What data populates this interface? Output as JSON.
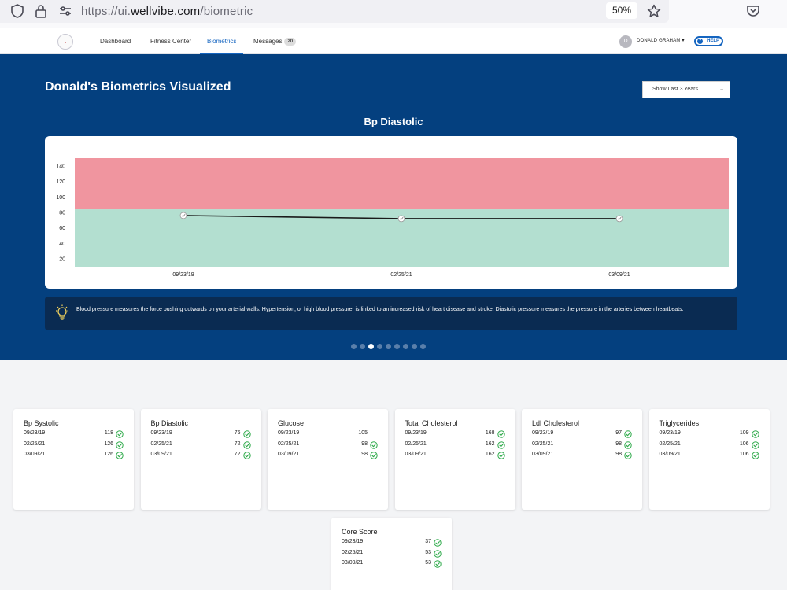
{
  "browser": {
    "url_prefix": "https://ui.",
    "url_domain": "wellvibe.com",
    "url_path": "/biometric",
    "zoom": "50%"
  },
  "nav": {
    "links": [
      "Dashboard",
      "Fitness Center",
      "Biometrics",
      "Messages"
    ],
    "messages_count": "20",
    "avatar_initial": "D",
    "user_name": "DONALD GRAHAM",
    "help_label": "HELP"
  },
  "hero": {
    "title": "Donald's Biometrics Visualized",
    "range_selected": "Show Last 3 Years",
    "tip": "Blood pressure measures the force pushing outwards on your arterial walls. Hypertension, or high blood pressure, is linked to an increased risk of heart disease and stroke. Diastolic pressure measures the pressure in the arteries between heartbeats.",
    "carousel_total": 9,
    "carousel_active": 3
  },
  "chart_data": {
    "type": "line",
    "title": "Bp Diastolic",
    "categories": [
      "09/23/19",
      "02/25/21",
      "03/09/21"
    ],
    "values": [
      76,
      72,
      72
    ],
    "yticks": [
      20,
      40,
      60,
      80,
      100,
      120,
      140
    ],
    "ylim": [
      10,
      150
    ],
    "bands": [
      {
        "from": 10,
        "to": 84,
        "color": "#b3dfd0"
      },
      {
        "from": 84,
        "to": 150,
        "color": "#f0959f"
      }
    ],
    "line_color": "#1a1a1a",
    "grid": false
  },
  "colors": {
    "hero_bg": "#04407f",
    "accent": "#1565c0",
    "ok_green": "#2eaa4a"
  },
  "cards": [
    {
      "title": "Bp Systolic",
      "rows": [
        {
          "date": "09/23/19",
          "value": "118"
        },
        {
          "date": "02/25/21",
          "value": "126"
        },
        {
          "date": "03/09/21",
          "value": "126"
        }
      ]
    },
    {
      "title": "Bp Diastolic",
      "rows": [
        {
          "date": "09/23/19",
          "value": "76"
        },
        {
          "date": "02/25/21",
          "value": "72"
        },
        {
          "date": "03/09/21",
          "value": "72"
        }
      ]
    },
    {
      "title": "Glucose",
      "rows": [
        {
          "date": "09/23/19",
          "value": "105"
        },
        {
          "date": "02/25/21",
          "value": "98"
        },
        {
          "date": "03/09/21",
          "value": "98"
        }
      ]
    },
    {
      "title": "Total Cholesterol",
      "rows": [
        {
          "date": "09/23/19",
          "value": "168"
        },
        {
          "date": "02/25/21",
          "value": "162"
        },
        {
          "date": "03/09/21",
          "value": "162"
        }
      ]
    },
    {
      "title": "Ldl Cholesterol",
      "rows": [
        {
          "date": "09/23/19",
          "value": "97"
        },
        {
          "date": "02/25/21",
          "value": "98"
        },
        {
          "date": "03/09/21",
          "value": "98"
        }
      ]
    },
    {
      "title": "Triglycerides",
      "rows": [
        {
          "date": "09/23/19",
          "value": "109"
        },
        {
          "date": "02/25/21",
          "value": "106"
        },
        {
          "date": "03/09/21",
          "value": "106"
        }
      ]
    },
    {
      "title": "Core Score",
      "rows": [
        {
          "date": "09/23/19",
          "value": "37"
        },
        {
          "date": "02/25/21",
          "value": "53"
        },
        {
          "date": "03/09/21",
          "value": "53"
        }
      ]
    }
  ]
}
